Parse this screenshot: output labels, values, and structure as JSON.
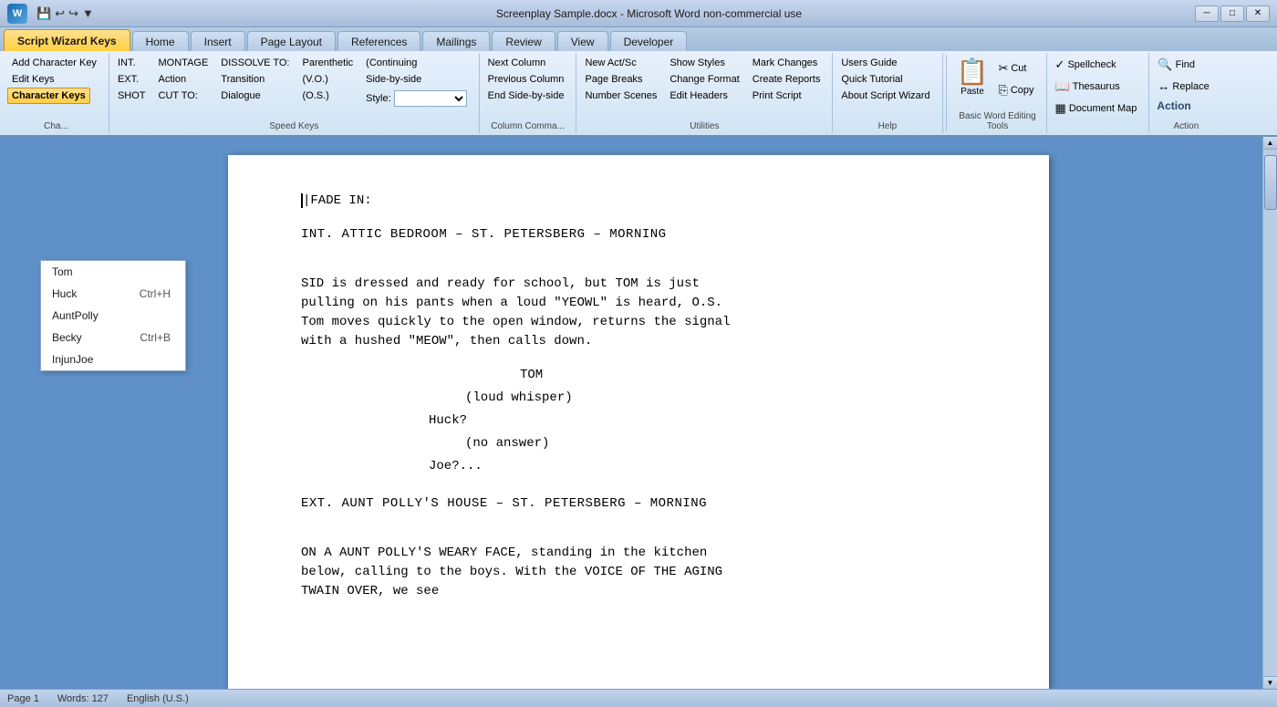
{
  "titleBar": {
    "appIcon": "W",
    "title": "Screenplay Sample.docx - Microsoft Word non-commercial use",
    "minimize": "─",
    "maximize": "□",
    "close": "✕"
  },
  "tabs": [
    {
      "label": "Script Wizard Keys",
      "active": true,
      "id": "script-wizard-keys"
    },
    {
      "label": "Home",
      "active": false,
      "id": "home"
    },
    {
      "label": "Insert",
      "active": false,
      "id": "insert"
    },
    {
      "label": "Page Layout",
      "active": false,
      "id": "page-layout"
    },
    {
      "label": "References",
      "active": false,
      "id": "references"
    },
    {
      "label": "Mailings",
      "active": false,
      "id": "mailings"
    },
    {
      "label": "Review",
      "active": false,
      "id": "review"
    },
    {
      "label": "View",
      "active": false,
      "id": "view"
    },
    {
      "label": "Developer",
      "active": false,
      "id": "developer"
    }
  ],
  "ribbon": {
    "groups": [
      {
        "id": "char-keys",
        "label": "Cha...",
        "items": [
          {
            "label": "Add Character Key",
            "type": "small"
          },
          {
            "label": "Edit Keys",
            "type": "small"
          },
          {
            "label": "Character Keys",
            "type": "small-highlighted"
          }
        ]
      },
      {
        "id": "speed-keys",
        "label": "Speed Keys",
        "columns": [
          {
            "rows": [
              {
                "label": "INT.",
                "type": "small"
              },
              {
                "label": "EXT.",
                "type": "small"
              },
              {
                "label": "SHOT",
                "type": "small"
              }
            ]
          },
          {
            "rows": [
              {
                "label": "MONTAGE",
                "type": "small"
              },
              {
                "label": "Action",
                "type": "small"
              },
              {
                "label": "CUT TO:",
                "type": "small"
              }
            ]
          },
          {
            "rows": [
              {
                "label": "DISSOLVE TO:",
                "type": "small"
              },
              {
                "label": "Transition",
                "type": "small"
              },
              {
                "label": "Dialogue",
                "type": "small"
              }
            ]
          },
          {
            "rows": [
              {
                "label": "Parenthetic",
                "type": "small"
              },
              {
                "label": "(V.O.)",
                "type": "small"
              },
              {
                "label": "(O.S.)",
                "type": "small"
              }
            ]
          },
          {
            "rows": [
              {
                "label": "(Continuing",
                "type": "small"
              },
              {
                "label": "Side-by-side",
                "type": "small"
              },
              {
                "label": "Style:",
                "type": "select",
                "value": ""
              }
            ]
          }
        ]
      },
      {
        "id": "column-commands",
        "label": "Column Comma...",
        "items": [
          {
            "label": "Next Column",
            "type": "small"
          },
          {
            "label": "Previous Column",
            "type": "small"
          },
          {
            "label": "End Side-by-side",
            "type": "small"
          }
        ]
      },
      {
        "id": "utilities",
        "label": "Utilities",
        "columns": [
          {
            "rows": [
              {
                "label": "New Act/Sc",
                "type": "small"
              },
              {
                "label": "Page Breaks",
                "type": "small"
              },
              {
                "label": "Number Scenes",
                "type": "small"
              }
            ]
          },
          {
            "rows": [
              {
                "label": "Show Styles",
                "type": "small"
              },
              {
                "label": "Change Format",
                "type": "small"
              },
              {
                "label": "Edit Headers",
                "type": "small"
              }
            ]
          },
          {
            "rows": [
              {
                "label": "Mark Changes",
                "type": "small"
              },
              {
                "label": "Create Reports",
                "type": "small"
              },
              {
                "label": "Print Script",
                "type": "small"
              }
            ]
          }
        ]
      },
      {
        "id": "help",
        "label": "Help",
        "items": [
          {
            "label": "Users Guide",
            "type": "small"
          },
          {
            "label": "Quick Tutorial",
            "type": "small"
          },
          {
            "label": "About Script Wizard",
            "type": "small"
          }
        ]
      },
      {
        "id": "clipboard",
        "label": "Basic Word Editing Tools",
        "items": [
          {
            "label": "Cut",
            "icon": "✂",
            "type": "inline"
          },
          {
            "label": "Copy",
            "icon": "⎘",
            "type": "inline"
          },
          {
            "label": "Paste",
            "icon": "📋",
            "type": "large"
          }
        ]
      },
      {
        "id": "font",
        "label": "Basic Word Editing Tools",
        "items": [
          {
            "label": "Spellcheck",
            "icon": "✓",
            "type": "inline"
          },
          {
            "label": "Thesaurus",
            "icon": "📖",
            "type": "inline"
          },
          {
            "label": "Document Map",
            "icon": "▦",
            "type": "inline"
          }
        ]
      },
      {
        "id": "find",
        "label": "Action",
        "items": [
          {
            "label": "Find",
            "icon": "🔍",
            "type": "inline"
          },
          {
            "label": "Replace",
            "icon": "↔",
            "type": "inline"
          },
          {
            "label": "Action",
            "icon": "",
            "type": "header"
          }
        ]
      }
    ]
  },
  "characterMenu": {
    "items": [
      {
        "name": "Tom",
        "shortcut": ""
      },
      {
        "name": "Huck",
        "shortcut": "Ctrl+H"
      },
      {
        "name": "AuntPolly",
        "shortcut": ""
      },
      {
        "name": "Becky",
        "shortcut": "Ctrl+B"
      },
      {
        "name": "InjunJoe",
        "shortcut": ""
      }
    ]
  },
  "document": {
    "fadeIn": "FADE IN:",
    "scene1": "INT. ATTIC BEDROOM – ST. PETERSBERG – MORNING",
    "action1": "SID is dressed and ready for school, but TOM is just\npulling on his pants when a loud \"YEOWL\" is heard, O.S.\nTom moves quickly to the open window, returns the signal\nwith a hushed \"MEOW\", then calls down.",
    "character1": "TOM",
    "parenthetical1": "(loud whisper)",
    "dialogue1": "Huck?",
    "parenthetical2": "(no answer)",
    "dialogue2": "Joe?...",
    "scene2": "EXT.   AUNT POLLY'S HOUSE – ST. PETERSBERG – MORNING",
    "action2": "ON A AUNT POLLY'S WEARY FACE, standing in the kitchen\nbelow, calling to the boys. With the VOICE OF THE AGING\nTWAIN OVER, we see"
  },
  "statusBar": {
    "page": "Page 1",
    "words": "Words: 127",
    "lang": "English (U.S.)"
  }
}
